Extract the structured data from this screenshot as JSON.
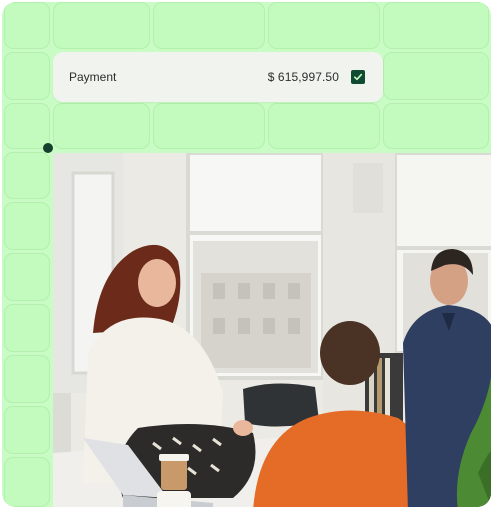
{
  "payment": {
    "label": "Payment",
    "amount": "$ 615,997.50",
    "confirmed": true
  },
  "colors": {
    "grid_background": "#c9fcc4",
    "check_fill": "#0f4a33",
    "dot": "#14402e"
  },
  "photo": {
    "subject": "office-meeting-photo"
  },
  "icons": {
    "checkbox": "check-icon"
  }
}
